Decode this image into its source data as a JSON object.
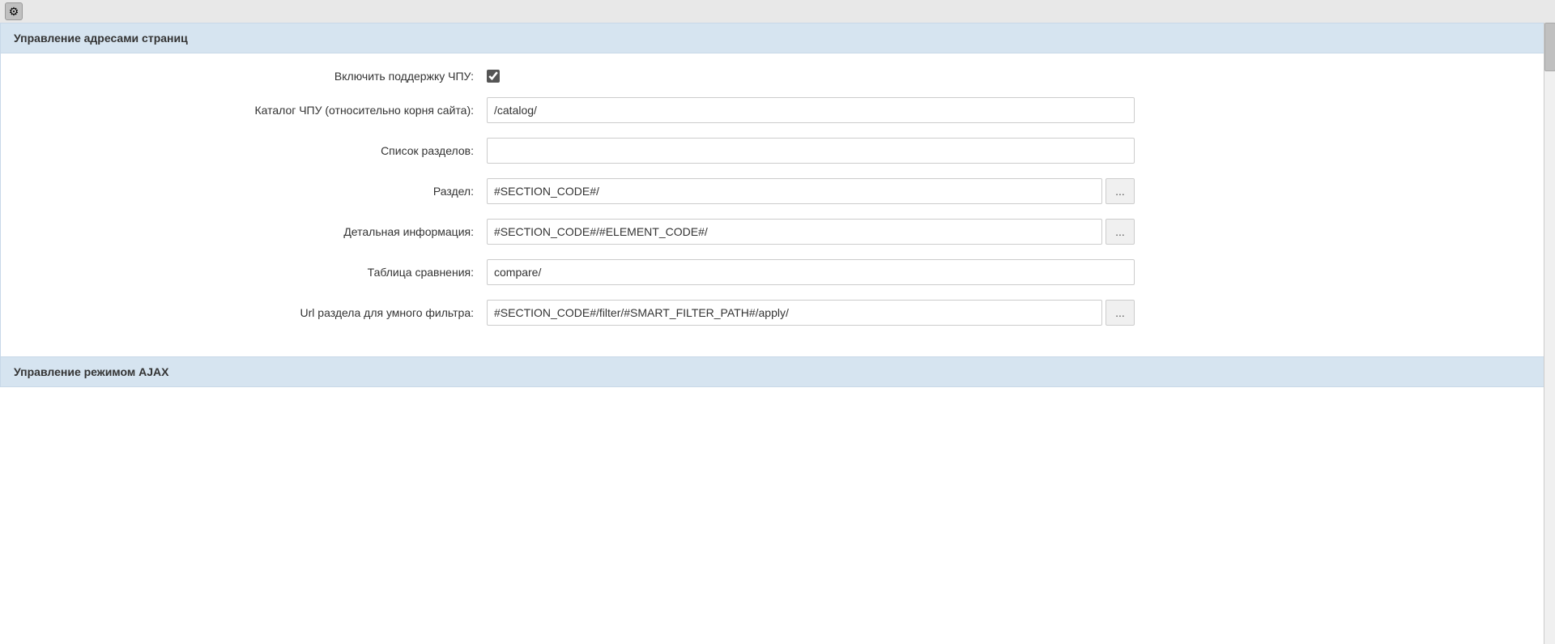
{
  "topIcon": {
    "label": "⚙"
  },
  "section1": {
    "header": "Управление адресами страниц",
    "fields": [
      {
        "id": "enable-spu",
        "label": "Включить поддержку ЧПУ:",
        "type": "checkbox",
        "checked": true
      },
      {
        "id": "catalog-spu",
        "label": "Каталог ЧПУ (относительно корня сайта):",
        "type": "text",
        "value": "/catalog/",
        "hasBtn": false,
        "inputClass": "input-wide"
      },
      {
        "id": "section-list",
        "label": "Список разделов:",
        "type": "text",
        "value": "",
        "hasBtn": false,
        "inputClass": "input-wide"
      },
      {
        "id": "section",
        "label": "Раздел:",
        "type": "text",
        "value": "#SECTION_CODE#/",
        "hasBtn": true,
        "inputClass": "input-with-btn"
      },
      {
        "id": "detail-info",
        "label": "Детальная информация:",
        "type": "text",
        "value": "#SECTION_CODE#/#ELEMENT_CODE#/",
        "hasBtn": true,
        "inputClass": "input-with-btn"
      },
      {
        "id": "compare-table",
        "label": "Таблица сравнения:",
        "type": "text",
        "value": "compare/",
        "hasBtn": false,
        "inputClass": "input-wide"
      },
      {
        "id": "smart-filter-url",
        "label": "Url раздела для умного фильтра:",
        "type": "text",
        "value": "#SECTION_CODE#/filter/#SMART_FILTER_PATH#/apply/",
        "hasBtn": true,
        "inputClass": "input-with-btn"
      }
    ]
  },
  "section2": {
    "header": "Управление режимом AJAX"
  },
  "browseBtn": {
    "label": "..."
  }
}
